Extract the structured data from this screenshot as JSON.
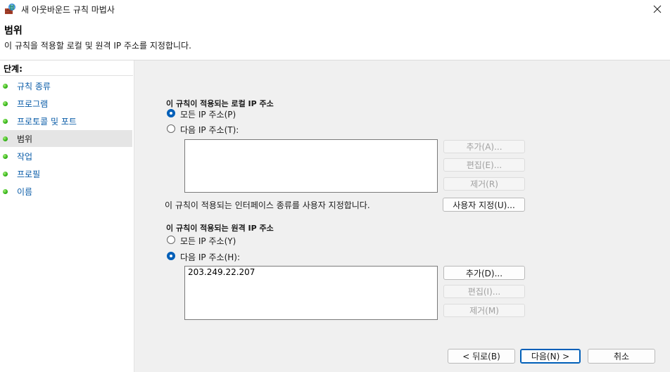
{
  "window": {
    "title": "새 아웃바운드 규칙 마법사",
    "icon": "firewall-icon",
    "close_icon": "close-icon"
  },
  "header": {
    "title": "범위",
    "subtitle": "이 규칙을 적용할 로컬 및 원격 IP 주소를 지정합니다."
  },
  "steps": {
    "heading": "단계:",
    "items": [
      {
        "label": "규칙 종류"
      },
      {
        "label": "프로그램"
      },
      {
        "label": "프로토콜 및 포트"
      },
      {
        "label": "범위",
        "current": true
      },
      {
        "label": "작업"
      },
      {
        "label": "프로필"
      },
      {
        "label": "이름"
      }
    ]
  },
  "local": {
    "title": "이 규칙이 적용되는 로컬 IP 주소",
    "option_any": "모든 IP 주소(P)",
    "option_these": "다음 IP 주소(T):",
    "selected": "any",
    "addresses": [],
    "add_label": "추가(A)...",
    "edit_label": "편집(E)...",
    "remove_label": "제거(R)"
  },
  "interface": {
    "text": "이 규칙이 적용되는 인터페이스 종류를 사용자 지정합니다.",
    "customize_label": "사용자 지정(U)..."
  },
  "remote": {
    "title": "이 규칙이 적용되는 원격 IP 주소",
    "option_any": "모든 IP 주소(Y)",
    "option_these": "다음 IP 주소(H):",
    "selected": "these",
    "addresses": [
      "203.249.22.207"
    ],
    "add_label": "추가(D)...",
    "edit_label": "편집(I)...",
    "remove_label": "제거(M)"
  },
  "footer": {
    "back_label": "< 뒤로(B)",
    "next_label": "다음(N) >",
    "cancel_label": "취소"
  },
  "colors": {
    "accent": "#005fb8",
    "link": "#0a5ca8",
    "step_dot": "#39b81c"
  }
}
